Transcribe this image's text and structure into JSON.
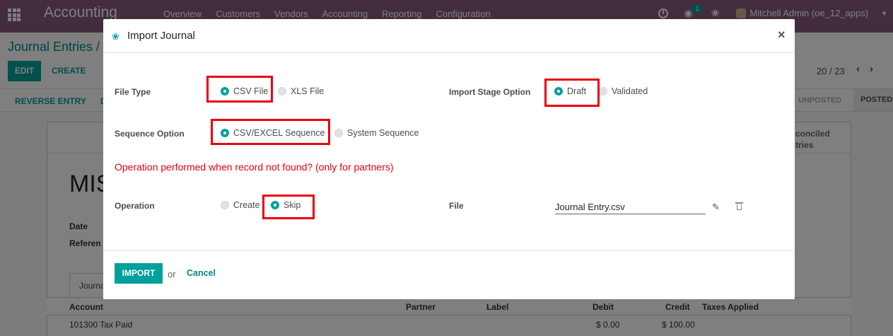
{
  "topbar": {
    "app_name": "Accounting",
    "menu": [
      "Overview",
      "Customers",
      "Vendors",
      "Accounting",
      "Reporting",
      "Configuration"
    ],
    "chat_count": "1",
    "user": "Mitchell Admin (oe_12_apps)",
    "color": "#875a7b"
  },
  "control_panel": {
    "breadcrumb": "Journal Entries /",
    "edit_label": "EDIT",
    "create_label": "CREATE",
    "pager": "20 / 23"
  },
  "status_bar": {
    "reverse_label": "REVERSE ENTRY",
    "truncated_label": "D",
    "states": [
      "UNPOSTED",
      "POSTED"
    ]
  },
  "sheet": {
    "reconcile_label": "conciled",
    "reconcile_label_2": "tries",
    "name": "MIS",
    "date_label": "Date",
    "reference_label": "Referen",
    "tab_label": "Journa",
    "columns": [
      "Account",
      "Partner",
      "Label",
      "Debit",
      "Credit",
      "Taxes Applied"
    ],
    "row": {
      "account": "101300 Tax Paid",
      "debit": "$ 0.00",
      "credit": "$ 100.00"
    }
  },
  "modal": {
    "title": "Import Journal",
    "file_type": {
      "label": "File Type",
      "options": [
        "CSV File",
        "XLS File"
      ],
      "selected": "CSV File"
    },
    "import_stage": {
      "label": "Import Stage Option",
      "options": [
        "Draft",
        "Validated"
      ],
      "selected": "Draft"
    },
    "sequence": {
      "label": "Sequence Option",
      "options": [
        "CSV/EXCEL Sequence",
        "System Sequence"
      ],
      "selected": "CSV/EXCEL Sequence"
    },
    "warning": "Operation performed when record not found? (only for partners)",
    "operation": {
      "label": "Operation",
      "options": [
        "Create",
        "Skip"
      ],
      "selected": "Skip"
    },
    "file": {
      "label": "File",
      "value": "Journal Entry.csv"
    },
    "import_label": "IMPORT",
    "or_label": "or",
    "cancel_label": "Cancel",
    "accent": "#00a09d",
    "highlight_color": "#e8000f"
  }
}
